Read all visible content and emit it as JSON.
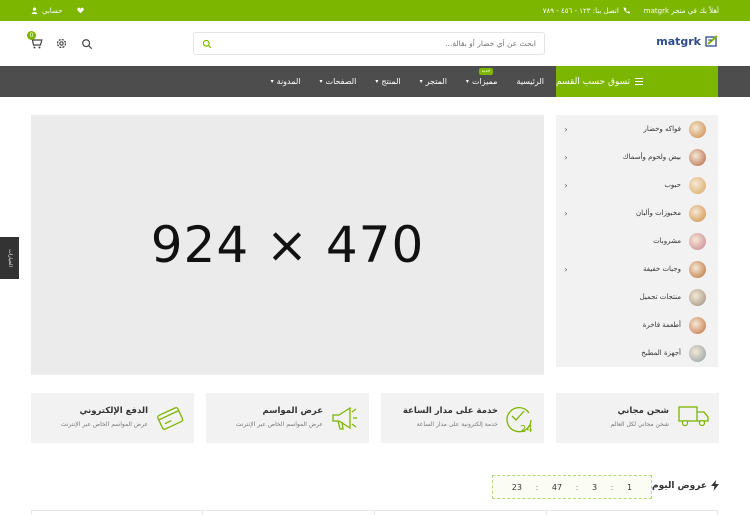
{
  "topbar": {
    "welcome": "أهلاً بك في متجر matgrk",
    "contact_label": "اتصل بنا: ١٢٣ - ٤٥٦ - ٧٨٩",
    "account_label": "حسابي"
  },
  "header": {
    "logo_text": "matgrk",
    "search_placeholder": "ابحث عن أي خضار أو بقالة...",
    "cart_count": "0"
  },
  "nav": {
    "category_button": "تسوق حسب القسم",
    "items": [
      {
        "label": "الرئيسية",
        "has_dropdown": false
      },
      {
        "label": "مميزات",
        "has_dropdown": true,
        "badge": "جديد"
      },
      {
        "label": "المتجر",
        "has_dropdown": true
      },
      {
        "label": "المنتج",
        "has_dropdown": true
      },
      {
        "label": "الصفحات",
        "has_dropdown": true
      },
      {
        "label": "المدونة",
        "has_dropdown": true
      }
    ]
  },
  "banner": {
    "placeholder_text": "924 × 470"
  },
  "side_tab": {
    "label": "الخيارات"
  },
  "categories": [
    {
      "label": "فواكه وخضار",
      "has_sub": true,
      "color": "#c9823a"
    },
    {
      "label": "بيض ولحوم وأسماك",
      "has_sub": true,
      "color": "#b5603d"
    },
    {
      "label": "حبوب",
      "has_sub": true,
      "color": "#d9a55a"
    },
    {
      "label": "مخبوزات وألبان",
      "has_sub": true,
      "color": "#d08a3c"
    },
    {
      "label": "مشروبات",
      "has_sub": false,
      "color": "#c77e8a"
    },
    {
      "label": "وجبات خفيفة",
      "has_sub": true,
      "color": "#b86a2e"
    },
    {
      "label": "منتجات تجميل",
      "has_sub": false,
      "color": "#9a8a7a"
    },
    {
      "label": "أطعمة فاخرة",
      "has_sub": false,
      "color": "#c26a3a"
    },
    {
      "label": "أجهزة المطبخ",
      "has_sub": false,
      "color": "#8a9aa0"
    }
  ],
  "features": [
    {
      "title": "شحن مجاني",
      "subtitle": "شحن مجاني لكل العالم",
      "icon": "truck-icon"
    },
    {
      "title": "خدمة على مدار الساعة",
      "subtitle": "خدمة إلكترونية على مدار الساعة",
      "icon": "clock-24-icon"
    },
    {
      "title": "عرض المواسم",
      "subtitle": "عرض المواسم الخاص عبر الإنترنت",
      "icon": "megaphone-icon"
    },
    {
      "title": "الدفع الإلكتروني",
      "subtitle": "عرض المواسم الخاص عبر الإنترنت",
      "icon": "credit-card-icon"
    }
  ],
  "deals": {
    "title": "عروض اليوم",
    "timer": [
      "1",
      "3",
      "47",
      "23"
    ]
  },
  "colors": {
    "accent": "#7db600",
    "nav_bg": "#4d4d4d",
    "panel_bg": "#f2f2f2"
  }
}
